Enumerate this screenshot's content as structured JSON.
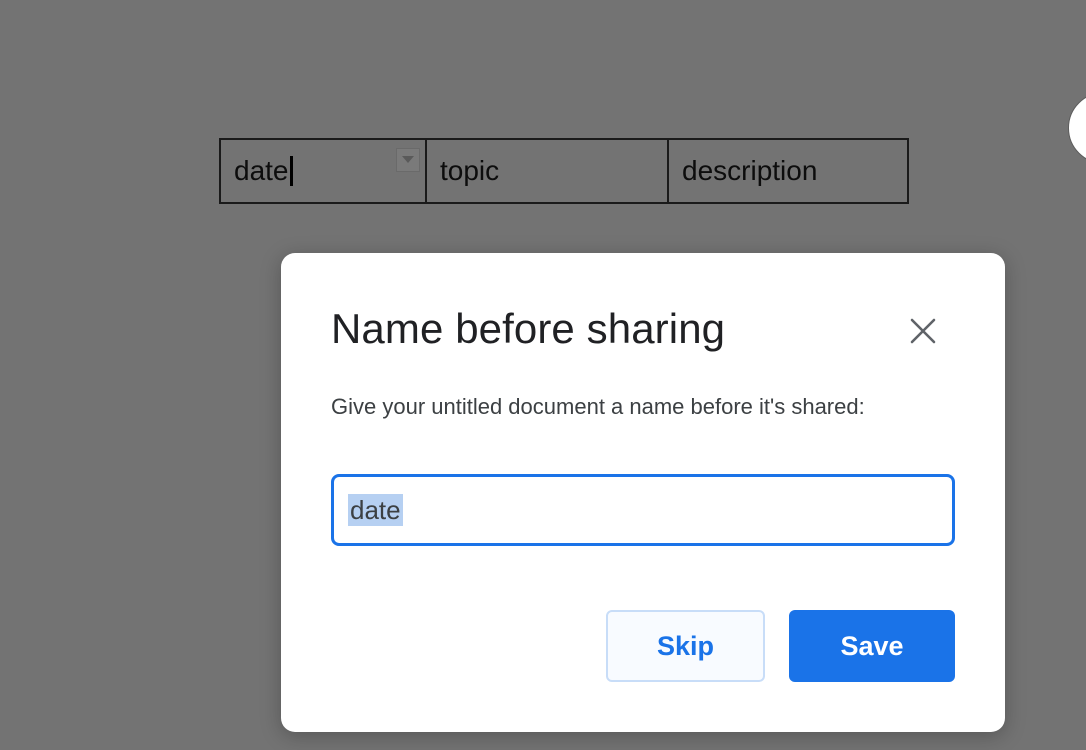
{
  "background_table": {
    "cells": [
      "date",
      "topic",
      "description"
    ],
    "first_cell_has_dropdown": true
  },
  "dialog": {
    "title": "Name before sharing",
    "message": "Give your untitled document a name before it's shared:",
    "input_value": "date",
    "buttons": {
      "skip_label": "Skip",
      "save_label": "Save"
    },
    "icons": {
      "close": "close-icon",
      "dropdown": "chevron-down-icon"
    }
  },
  "colors": {
    "overlay": "#737373",
    "accent": "#1a73e8",
    "selection": "#b6d0f2",
    "dialog_bg": "#ffffff",
    "title_text": "#202124",
    "body_text": "#3c4043"
  }
}
